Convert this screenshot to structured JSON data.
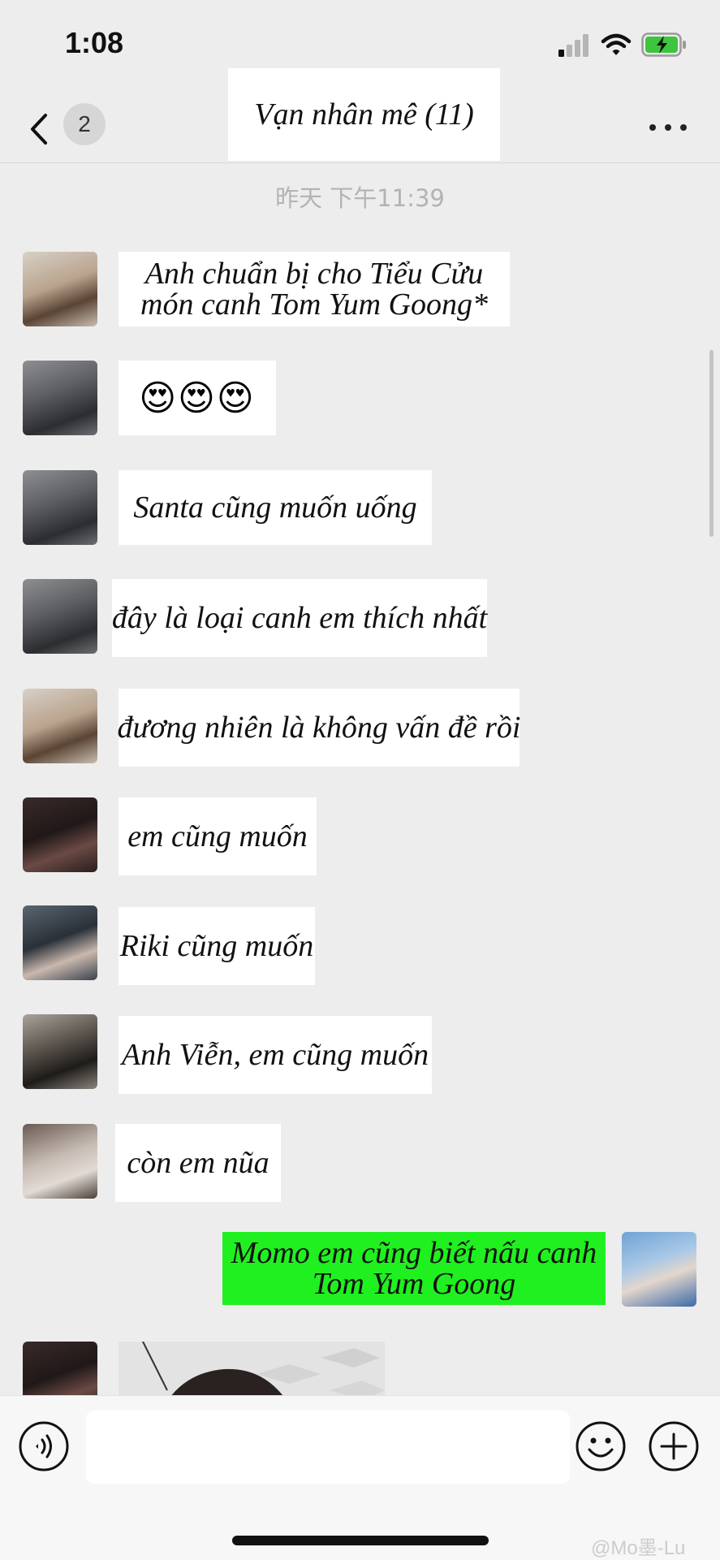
{
  "status_bar": {
    "time": "1:08"
  },
  "header": {
    "unread_count": "2",
    "title": "Vạn nhân mê (11)"
  },
  "chat": {
    "timestamp": "昨天 下午11:39",
    "messages": [
      {
        "text_line1": "Anh chuẩn bị cho Tiểu Cửu",
        "text_line2": "món canh Tom Yum Goong*"
      },
      {
        "text": "😍😍😍"
      },
      {
        "text": "Santa cũng muốn uống"
      },
      {
        "text": "đây là loại canh em thích nhất"
      },
      {
        "text": "đương nhiên là không vấn đề rồi"
      },
      {
        "text": "em cũng muốn"
      },
      {
        "text": "Riki cũng muốn"
      },
      {
        "text": "Anh Viễn, em cũng muốn"
      },
      {
        "text": "còn em nũa"
      },
      {
        "text_line1": "Momo em cũng biết nấu canh",
        "text_line2": "Tom Yum Goong"
      }
    ]
  },
  "colors": {
    "background": "#ededed",
    "sent_bubble": "#20f020",
    "received_bubble": "#ffffff"
  },
  "icons": {
    "back": "chevron-left-icon",
    "more": "more-dots-icon",
    "voice": "voice-icon",
    "emoji": "emoji-icon",
    "plus": "plus-icon"
  },
  "watermark": "@Mo墨-Lu"
}
